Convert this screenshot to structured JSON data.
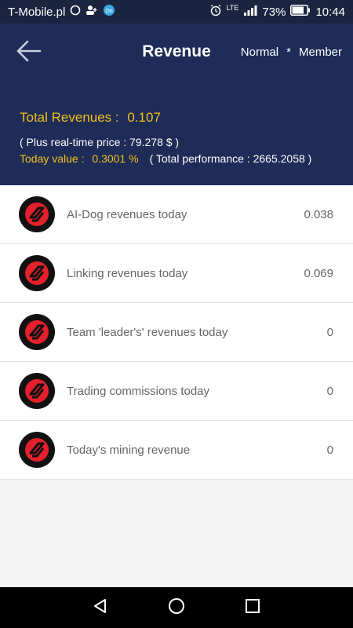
{
  "status_bar": {
    "carrier": "T-Mobile.pl",
    "network": "LTE",
    "battery": "73%",
    "time": "10:44"
  },
  "header": {
    "title": "Revenue",
    "role_normal": "Normal",
    "role_separator": "*",
    "role_member": "Member"
  },
  "summary": {
    "total_label": "Total Revenues :",
    "total_value": "0.107",
    "price_text": "( Plus real-time price :   79.278 $ )",
    "today_label": "Today value :",
    "today_value": "0.3001 %",
    "performance_text": "( Total performance :  2665.2058 )"
  },
  "revenues": [
    {
      "label": "AI-Dog revenues today",
      "value": "0.038"
    },
    {
      "label": "Linking revenues today",
      "value": "0.069"
    },
    {
      "label": "Team 'leader's' revenues today",
      "value": "0"
    },
    {
      "label": "Trading commissions today",
      "value": "0"
    },
    {
      "label": "Today's mining revenue",
      "value": "0"
    }
  ],
  "colors": {
    "header_bg": "#1e2c57",
    "accent_yellow": "#f3c119",
    "icon_red": "#e3202b"
  },
  "icons": {
    "back": "arrow-left-icon",
    "revenue_item": "brand-logo-icon",
    "nav_back": "triangle-back-icon",
    "nav_home": "circle-home-icon",
    "nav_recents": "square-recents-icon"
  }
}
